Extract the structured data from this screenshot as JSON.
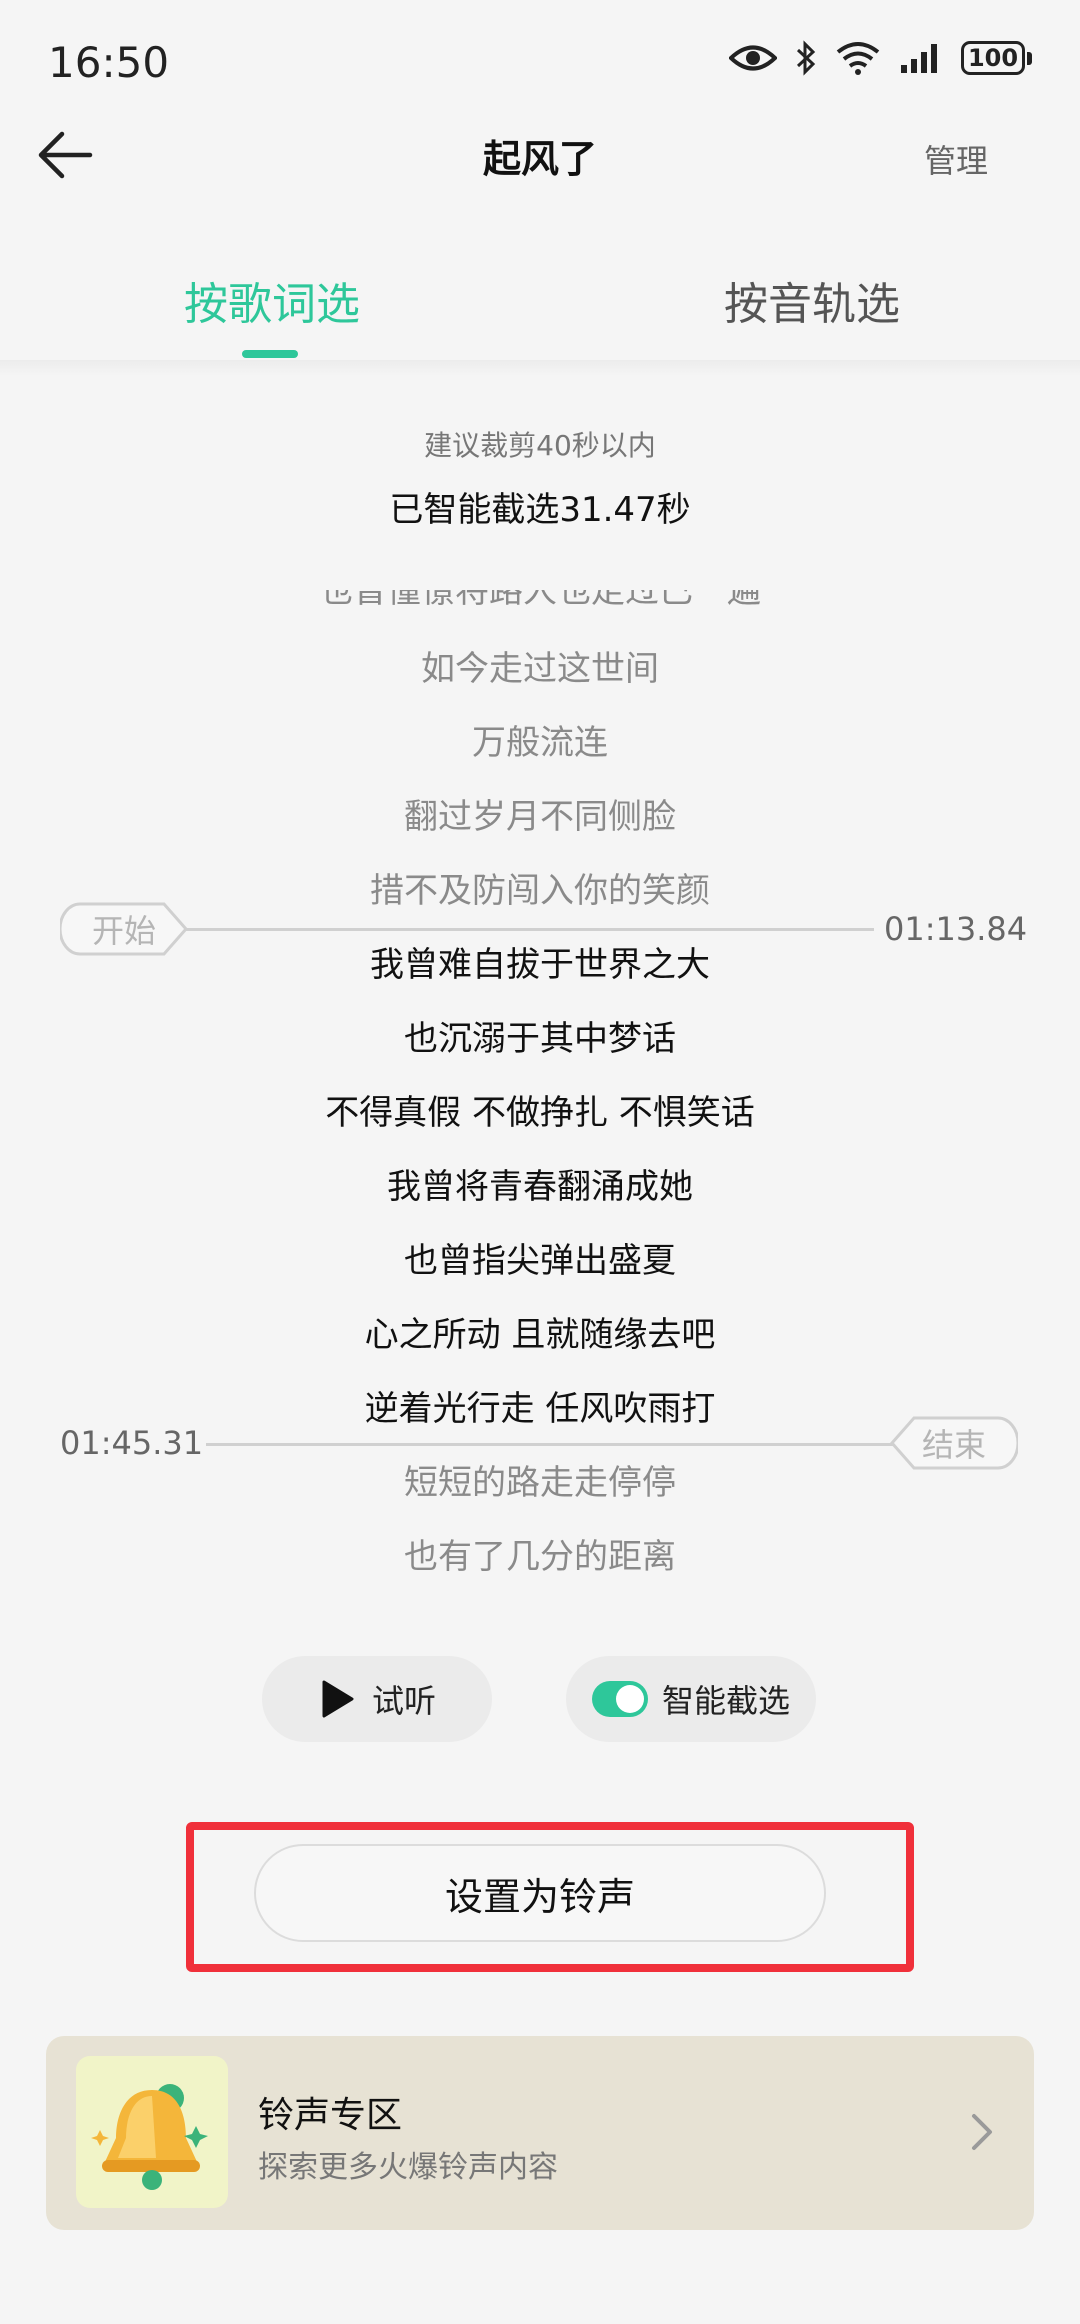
{
  "status_bar": {
    "time": "16:50",
    "battery": "100",
    "icons": [
      "eye-icon",
      "bluetooth-icon",
      "wifi-icon",
      "signal-icon",
      "battery-icon"
    ]
  },
  "header": {
    "title": "起风了",
    "manage_label": "管理",
    "back_icon": "back-arrow-icon"
  },
  "tabs": [
    {
      "label": "按歌词选",
      "active": true
    },
    {
      "label": "按音轨选",
      "active": false
    }
  ],
  "accent_color": "#2ec79a",
  "hint": "建议裁剪40秒以内",
  "selection_status": "已智能截选31.47秒",
  "lyrics": {
    "partial_top": "也曾憧憬将路人也走过已一遍",
    "lines": [
      {
        "text": "如今走过这世间",
        "selected": false
      },
      {
        "text": "万般流连",
        "selected": false
      },
      {
        "text": "翻过岁月不同侧脸",
        "selected": false
      },
      {
        "text": "措不及防闯入你的笑颜",
        "selected": false
      },
      {
        "text": "我曾难自拔于世界之大",
        "selected": true
      },
      {
        "text": "也沉溺于其中梦话",
        "selected": true
      },
      {
        "text": "不得真假 不做挣扎 不惧笑话",
        "selected": true
      },
      {
        "text": "我曾将青春翻涌成她",
        "selected": true
      },
      {
        "text": "也曾指尖弹出盛夏",
        "selected": true
      },
      {
        "text": "心之所动 且就随缘去吧",
        "selected": true
      },
      {
        "text": "逆着光行走 任风吹雨打",
        "selected": true
      },
      {
        "text": "短短的路走走停停",
        "selected": false
      },
      {
        "text": "也有了几分的距离",
        "selected": false
      }
    ]
  },
  "start_marker": {
    "label": "开始",
    "time": "01:13.84"
  },
  "end_marker": {
    "label": "结束",
    "time": "01:45.31"
  },
  "controls": {
    "play_label": "试听",
    "smart_label": "智能截选",
    "smart_enabled": true
  },
  "set_ringtone_label": "设置为铃声",
  "highlight_color": "#f0303a",
  "zone": {
    "title": "铃声专区",
    "subtitle": "探索更多火爆铃声内容",
    "icon": "bell-icon"
  }
}
